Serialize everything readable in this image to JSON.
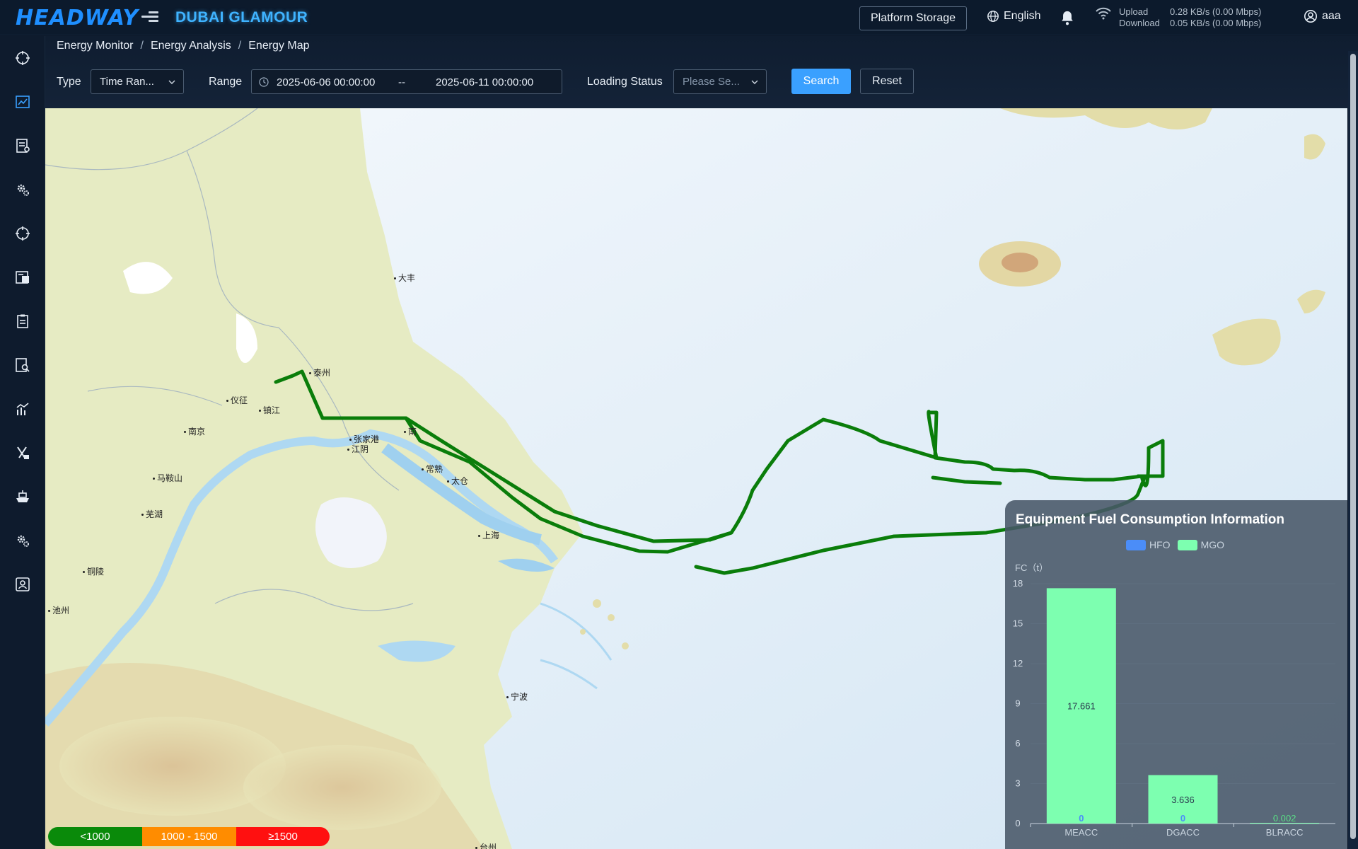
{
  "header": {
    "logo": "HEADWAY",
    "ship_name": "DUBAI GLAMOUR",
    "platform_button": "Platform Storage",
    "language": "English",
    "network": {
      "upload_label": "Upload",
      "upload_value": "0.28 KB/s (0.00 Mbps)",
      "download_label": "Download",
      "download_value": "0.05 KB/s (0.00 Mbps)"
    },
    "user": "aaa"
  },
  "breadcrumb": [
    "Energy Monitor",
    "Energy Analysis",
    "Energy Map"
  ],
  "filters": {
    "type_label": "Type",
    "type_value": "Time Ran...",
    "range_label": "Range",
    "range_start": "2025-06-06 00:00:00",
    "range_sep": "--",
    "range_end": "2025-06-11 00:00:00",
    "loading_label": "Loading Status",
    "loading_placeholder": "Please Se...",
    "search_button": "Search",
    "reset_button": "Reset"
  },
  "sidebar": {
    "items": [
      "crosshair-icon",
      "chart-icon",
      "report-icon",
      "gears-icon",
      "target-icon",
      "document-list-icon",
      "clipboard-icon",
      "search-document-icon",
      "analytics-icon",
      "tools-icon",
      "ship-icon",
      "settings-icon",
      "user-card-icon"
    ],
    "active_index": 1
  },
  "map": {
    "cities": [
      "大丰",
      "泰州",
      "仪征",
      "镇江",
      "南京",
      "张家港",
      "江阴",
      "南",
      "常熟",
      "太仓",
      "马鞍山",
      "芜湖",
      "上海",
      "铜陵",
      "池州",
      "宁波",
      "台州"
    ],
    "route_color": "#0a7d0a"
  },
  "speed_legend": [
    {
      "label": "<1000",
      "color": "#0a8a0a"
    },
    {
      "label": "1000 - 1500",
      "color": "#ff8c00"
    },
    {
      "label": "≥1500",
      "color": "#ff1010"
    }
  ],
  "chart_data": {
    "type": "bar",
    "title": "Equipment Fuel Consumption Information",
    "ylabel": "FC（t）",
    "categories": [
      "MEACC",
      "DGACC",
      "BLRACC"
    ],
    "series": [
      {
        "name": "HFO",
        "color": "#4b8df8",
        "values": [
          0,
          0,
          0
        ]
      },
      {
        "name": "MGO",
        "color": "#7dffb0",
        "values": [
          17.661,
          3.636,
          0.002
        ]
      }
    ],
    "data_labels": {
      "HFO": [
        "0",
        "0",
        ""
      ],
      "MGO": [
        "17.661",
        "3.636",
        "0.002"
      ]
    },
    "yticks": [
      "0",
      "3",
      "6",
      "9",
      "12",
      "15",
      "18"
    ],
    "ylim": [
      0,
      18
    ],
    "grid": true,
    "legend": "top-center"
  }
}
